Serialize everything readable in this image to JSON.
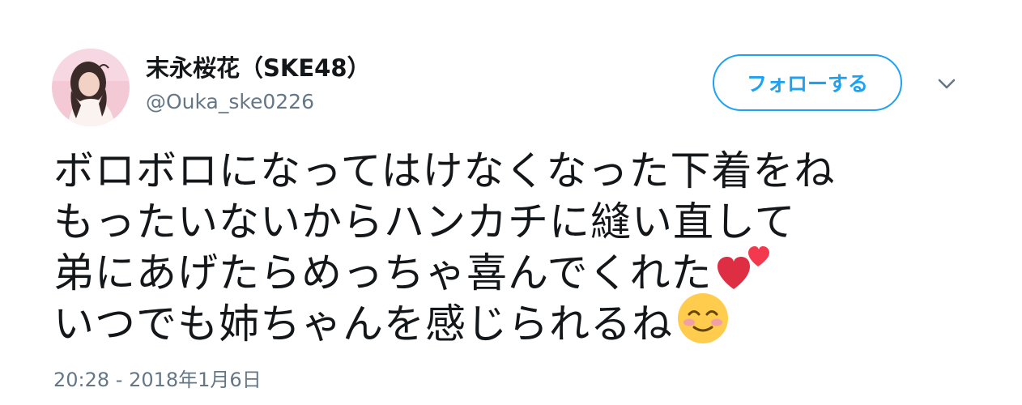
{
  "user": {
    "display_name": "末永桜花（SKE48）",
    "handle": "@Ouka_ske0226"
  },
  "actions": {
    "follow_label": "フォローする",
    "more_icon": "chevron-down-icon"
  },
  "tweet": {
    "lines": [
      "ボロボロになってはけなくなった下着をね",
      "もったいないからハンカチに縫い直して",
      "弟にあげたらめっちゃ喜んでくれた",
      "いつでも姉ちゃんを感じられるね"
    ],
    "emojis": [
      "two-hearts-icon",
      "smiling-face-icon"
    ],
    "timestamp": "20:28 - 2018年1月6日"
  },
  "colors": {
    "accent": "#1da1f2",
    "text": "#14171a",
    "muted": "#657786"
  }
}
